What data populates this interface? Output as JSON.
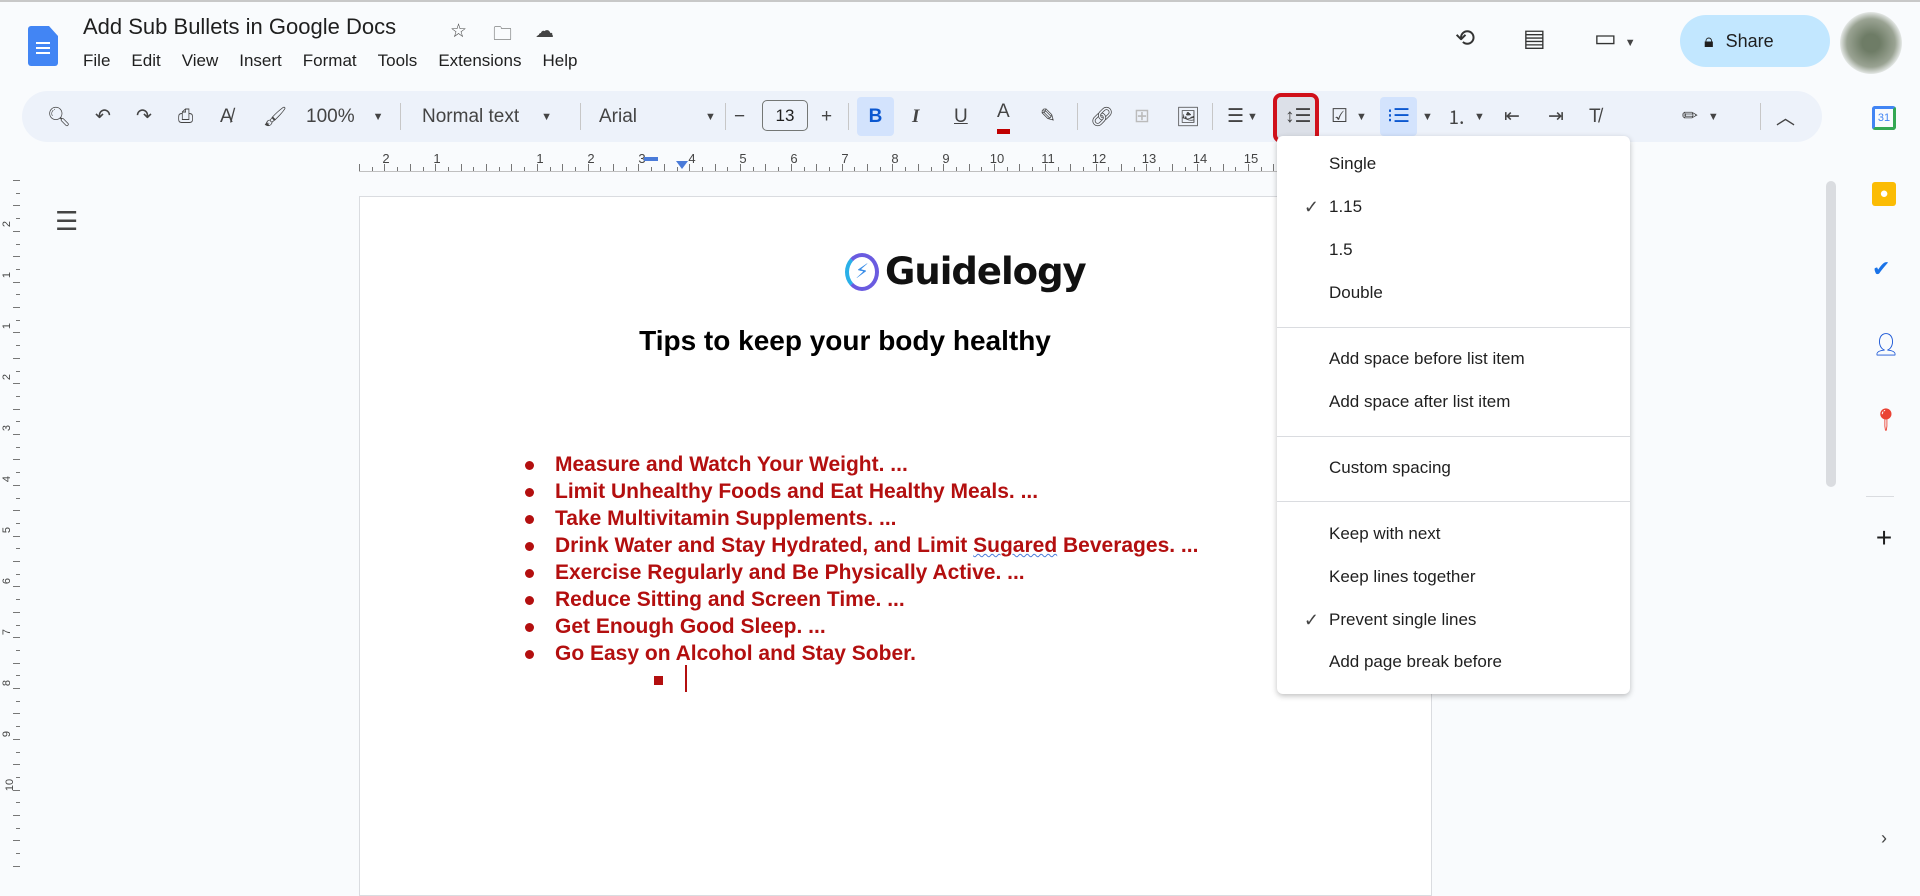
{
  "header": {
    "title": "Add Sub Bullets in Google Docs",
    "menu": [
      "File",
      "Edit",
      "View",
      "Insert",
      "Format",
      "Tools",
      "Extensions",
      "Help"
    ],
    "share_label": "Share"
  },
  "toolbar": {
    "zoom": "100%",
    "style": "Normal text",
    "font": "Arial",
    "font_size": "13",
    "bold": "B",
    "italic": "I",
    "underline": "U",
    "text_color": "A",
    "text_color_hex": "#c00000"
  },
  "ruler": {
    "labels": [
      "2",
      "1",
      "1",
      "2",
      "3",
      "4",
      "5",
      "6",
      "7",
      "8",
      "9",
      "10",
      "11",
      "12",
      "13",
      "14",
      "15"
    ]
  },
  "vruler": {
    "labels": [
      "2",
      "1",
      "1",
      "2",
      "3",
      "4",
      "5",
      "6",
      "7",
      "8",
      "9",
      "10"
    ]
  },
  "document": {
    "logo_text": "Guidelogy",
    "heading": "Tips to keep your body healthy",
    "items": [
      "Measure and Watch Your Weight. ...",
      "Limit Unhealthy Foods and Eat Healthy Meals. ...",
      "Take Multivitamin Supplements. ...",
      "Drink Water and Stay Hydrated, and Limit ",
      "Exercise Regularly and Be Physically Active. ...",
      "Reduce Sitting and Screen Time. ...",
      "Get Enough Good Sleep. ...",
      "Go Easy on Alcohol and Stay Sober."
    ],
    "item4_misspelled": "Sugared",
    "item4_tail": " Beverages. ...",
    "text_color": "#b30f0f"
  },
  "line_spacing_menu": {
    "items": [
      {
        "label": "Single",
        "checked": false
      },
      {
        "label": "1.15",
        "checked": true
      },
      {
        "label": "1.5",
        "checked": false
      },
      {
        "label": "Double",
        "checked": false
      },
      {
        "label": "Add space before list item",
        "checked": false
      },
      {
        "label": "Add space after list item",
        "checked": false
      },
      {
        "label": "Custom spacing",
        "checked": false
      },
      {
        "label": "Keep with next",
        "checked": false
      },
      {
        "label": "Keep lines together",
        "checked": false
      },
      {
        "label": "Prevent single lines",
        "checked": true
      },
      {
        "label": "Add page break before",
        "checked": false
      }
    ],
    "check_glyph": "✓"
  },
  "side_panel": {
    "calendar_day": "31"
  },
  "colors": {
    "highlight_box": "#d0101a",
    "accent": "#c2e7ff"
  }
}
